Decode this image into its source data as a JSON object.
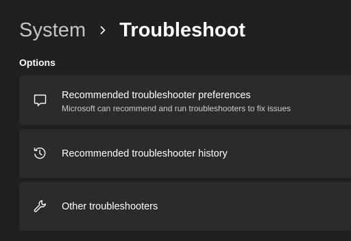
{
  "header": {
    "breadcrumb_parent": "System",
    "breadcrumb_separator_icon": "chevron-right-icon",
    "breadcrumb_current": "Troubleshoot"
  },
  "section": {
    "label": "Options"
  },
  "options": [
    {
      "icon": "chat-bubble-icon",
      "title": "Recommended troubleshooter preferences",
      "description": "Microsoft can recommend and run troubleshooters to fix issues"
    },
    {
      "icon": "history-icon",
      "title": "Recommended troubleshooter history"
    },
    {
      "icon": "wrench-icon",
      "title": "Other troubleshooters"
    }
  ],
  "colors": {
    "background": "#202020",
    "card": "#2b2b2b",
    "text_primary": "#ffffff",
    "text_secondary": "#cfcfcf",
    "breadcrumb_parent": "#c5c5c5"
  }
}
